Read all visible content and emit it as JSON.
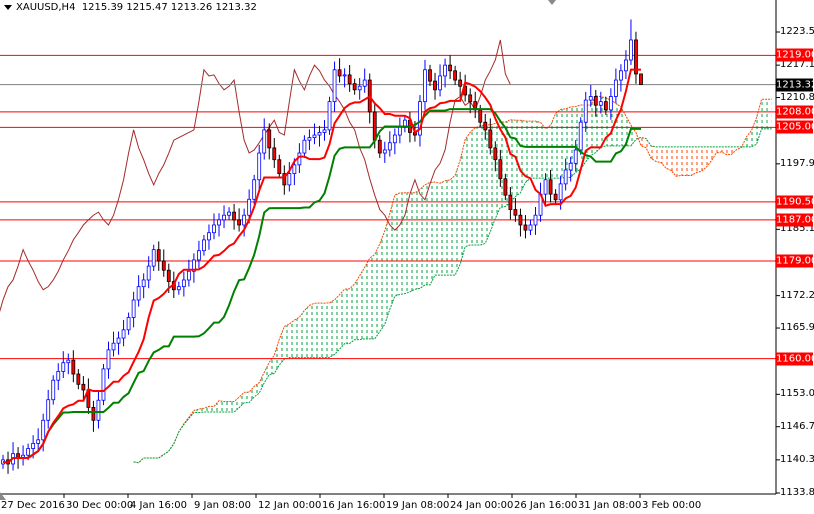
{
  "header": {
    "symbol": "XAUUSD,H4",
    "open": "1215.39",
    "high": "1215.47",
    "low": "1213.26",
    "close": "1213.32"
  },
  "chart_data": {
    "type": "candlestick",
    "title": "XAUUSD,H4",
    "indicator": "Ichimoku Kinko Hyo (9,26,52)",
    "ylim": [
      1133.85,
      1223.55
    ],
    "y_ticks": [
      "1223.55",
      "1217.10",
      "1210.80",
      "1197.90",
      "1185.15",
      "1172.25",
      "1165.95",
      "1153.05",
      "1146.75",
      "1140.30",
      "1133.85"
    ],
    "x_ticks": [
      "27 Dec 2016",
      "30 Dec 00:00",
      "4 Jan 16:00",
      "9 Jan 08:00",
      "12 Jan 00:00",
      "16 Jan 16:00",
      "19 Jan 08:00",
      "24 Jan 00:00",
      "26 Jan 16:00",
      "31 Jan 08:00",
      "3 Feb 00:00"
    ],
    "current_price": "1213.32",
    "levels": [
      "1219.00",
      "1208.00",
      "1205.00",
      "1190.50",
      "1187.00",
      "1179.00",
      "1160.00"
    ],
    "closes": [
      1140.3,
      1139.5,
      1141.5,
      1140.8,
      1141.2,
      1142.5,
      1143.5,
      1144.2,
      1148,
      1152,
      1155.8,
      1157.5,
      1159.2,
      1159.7,
      1157,
      1155,
      1153.9,
      1150.5,
      1148,
      1151.9,
      1158,
      1161.7,
      1163,
      1164,
      1165.6,
      1168,
      1171.4,
      1174,
      1175.3,
      1178,
      1181.2,
      1179,
      1177.2,
      1175,
      1173.4,
      1174,
      1175.3,
      1177,
      1179.2,
      1181,
      1183.1,
      1184.5,
      1186,
      1187,
      1187.9,
      1188.5,
      1187,
      1186,
      1187.9,
      1191,
      1194.8,
      1200,
      1204.5,
      1201,
      1198.7,
      1196,
      1193.8,
      1196,
      1197.7,
      1200,
      1202.5,
      1203,
      1203.5,
      1204,
      1204.5,
      1210,
      1216.2,
      1215,
      1215.2,
      1213.5,
      1212.3,
      1213,
      1214.2,
      1208,
      1202.5,
      1200,
      1200.6,
      1202,
      1203.5,
      1205,
      1206.4,
      1204,
      1203.5,
      1210,
      1216.2,
      1214,
      1212.3,
      1215,
      1217.1,
      1216,
      1214.2,
      1213,
      1211.3,
      1210,
      1208.4,
      1206,
      1204.5,
      1201,
      1198.7,
      1195,
      1191.8,
      1189,
      1187.9,
      1186,
      1185,
      1186,
      1187.9,
      1192,
      1194.8,
      1192,
      1190.9,
      1194,
      1196.7,
      1198,
      1200.6,
      1206,
      1210.3,
      1211,
      1209.3,
      1210,
      1208.4,
      1211,
      1214.2,
      1216,
      1218.1,
      1222,
      1215.39,
      1213.32
    ],
    "wick": 1.6,
    "colors": {
      "bull": "#0000ff",
      "bear": "#ff0000",
      "tenkan": "#ff0000",
      "kijun": "#008000",
      "chikou": "#a52a2a",
      "kumo_up": "#00a040",
      "kumo_down": "#ff4500",
      "level": "#ff0000",
      "current": "#808080"
    }
  }
}
